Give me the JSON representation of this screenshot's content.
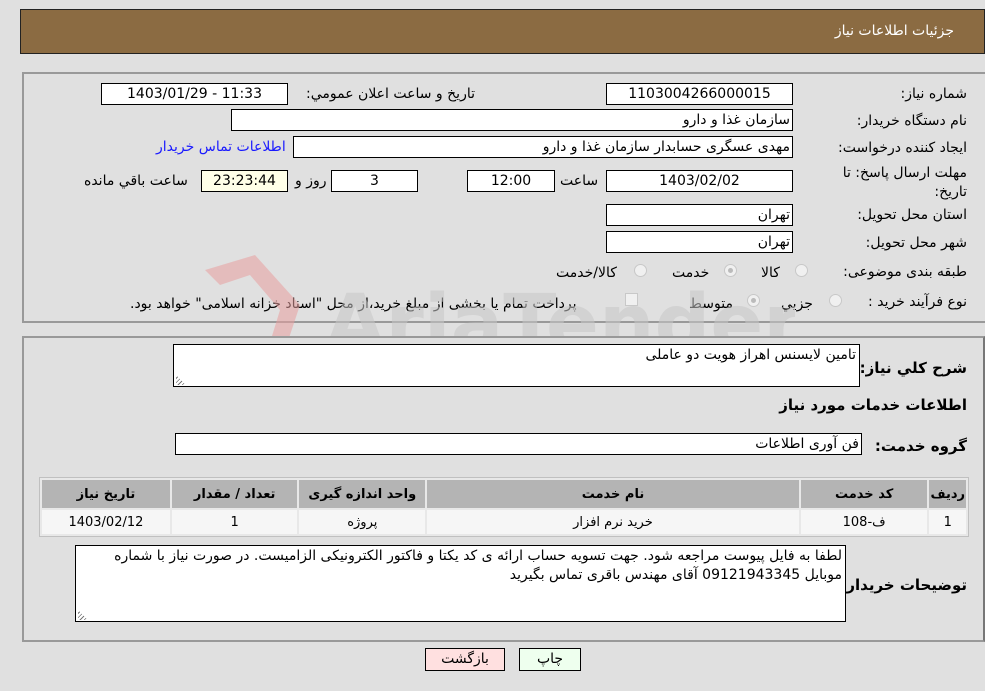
{
  "header": {
    "title": "جزئیات اطلاعات نیاز"
  },
  "form": {
    "need_number": {
      "label": "شماره نیاز:",
      "value": "1103004266000015"
    },
    "announce_datetime": {
      "label": "تاریخ و ساعت اعلان عمومي:",
      "value": "1403/01/29 - 11:33"
    },
    "buyer_org": {
      "label": "نام دستگاه خریدار:",
      "value": "سازمان غذا و دارو",
      "extra_value": ""
    },
    "creator": {
      "label": "ایجاد کننده درخواست:",
      "value": "مهدی عسگری حسابدار سازمان غذا و دارو"
    },
    "buyer_contact_link": "اطلاعات تماس خریدار",
    "deadline": {
      "label": "مهلت ارسال پاسخ: تا تاریخ:",
      "date": "1403/02/02",
      "time_label": "ساعت",
      "time": "12:00",
      "days": "3",
      "days_label": "روز و",
      "remaining": "23:23:44",
      "remaining_label": "ساعت باقي مانده"
    },
    "province": {
      "label": "استان محل تحویل:",
      "value": "تهران"
    },
    "city": {
      "label": "شهر محل تحویل:",
      "value": "تهران"
    },
    "category": {
      "label": "طبقه بندی موضوعی:",
      "options": [
        {
          "label": "کالا",
          "checked": false
        },
        {
          "label": "خدمت",
          "checked": true
        },
        {
          "label": "کالا/خدمت",
          "checked": false
        }
      ]
    },
    "purchase_type": {
      "label": "نوع فرآیند خرید :",
      "options": [
        {
          "label": "جزيي",
          "checked": false
        },
        {
          "label": "متوسط",
          "checked": true
        }
      ],
      "treasury_checkbox_label": "پرداخت تمام یا بخشی از مبلغ خرید،از محل \"اسناد خزانه اسلامی\" خواهد بود.",
      "treasury_checked": false
    }
  },
  "details": {
    "description_label": "شرح کلي نیاز:",
    "description": "تامین لایسنس اهراز هویت دو عاملی",
    "services_title": "اطلاعات خدمات مورد نیاز",
    "service_group_label": "گروه خدمت:",
    "service_group": "فن آوری اطلاعات",
    "table": {
      "headers": [
        "ردیف",
        "کد خدمت",
        "نام خدمت",
        "واحد اندازه گیری",
        "تعداد / مقدار",
        "تاریخ نیاز"
      ],
      "rows": [
        [
          "1",
          "ف-108",
          "خرید نرم افزار",
          "پروژه",
          "1",
          "1403/02/12"
        ]
      ]
    },
    "buyer_notes_label": "توضیحات خریدار:",
    "buyer_notes": "لطفا به فایل پیوست مراجعه شود. جهت تسویه حساب ارائه ی کد یکتا و فاکتور الکترونیکی الزامیست. در صورت نیاز با شماره موبایل 09121943345 آقای مهندس باقری تماس بگیرید"
  },
  "buttons": {
    "print": "چاپ",
    "back": "بازگشت"
  },
  "watermark": {
    "text": "AriaTender.neT",
    "logo_color": "#e8a0a0"
  }
}
